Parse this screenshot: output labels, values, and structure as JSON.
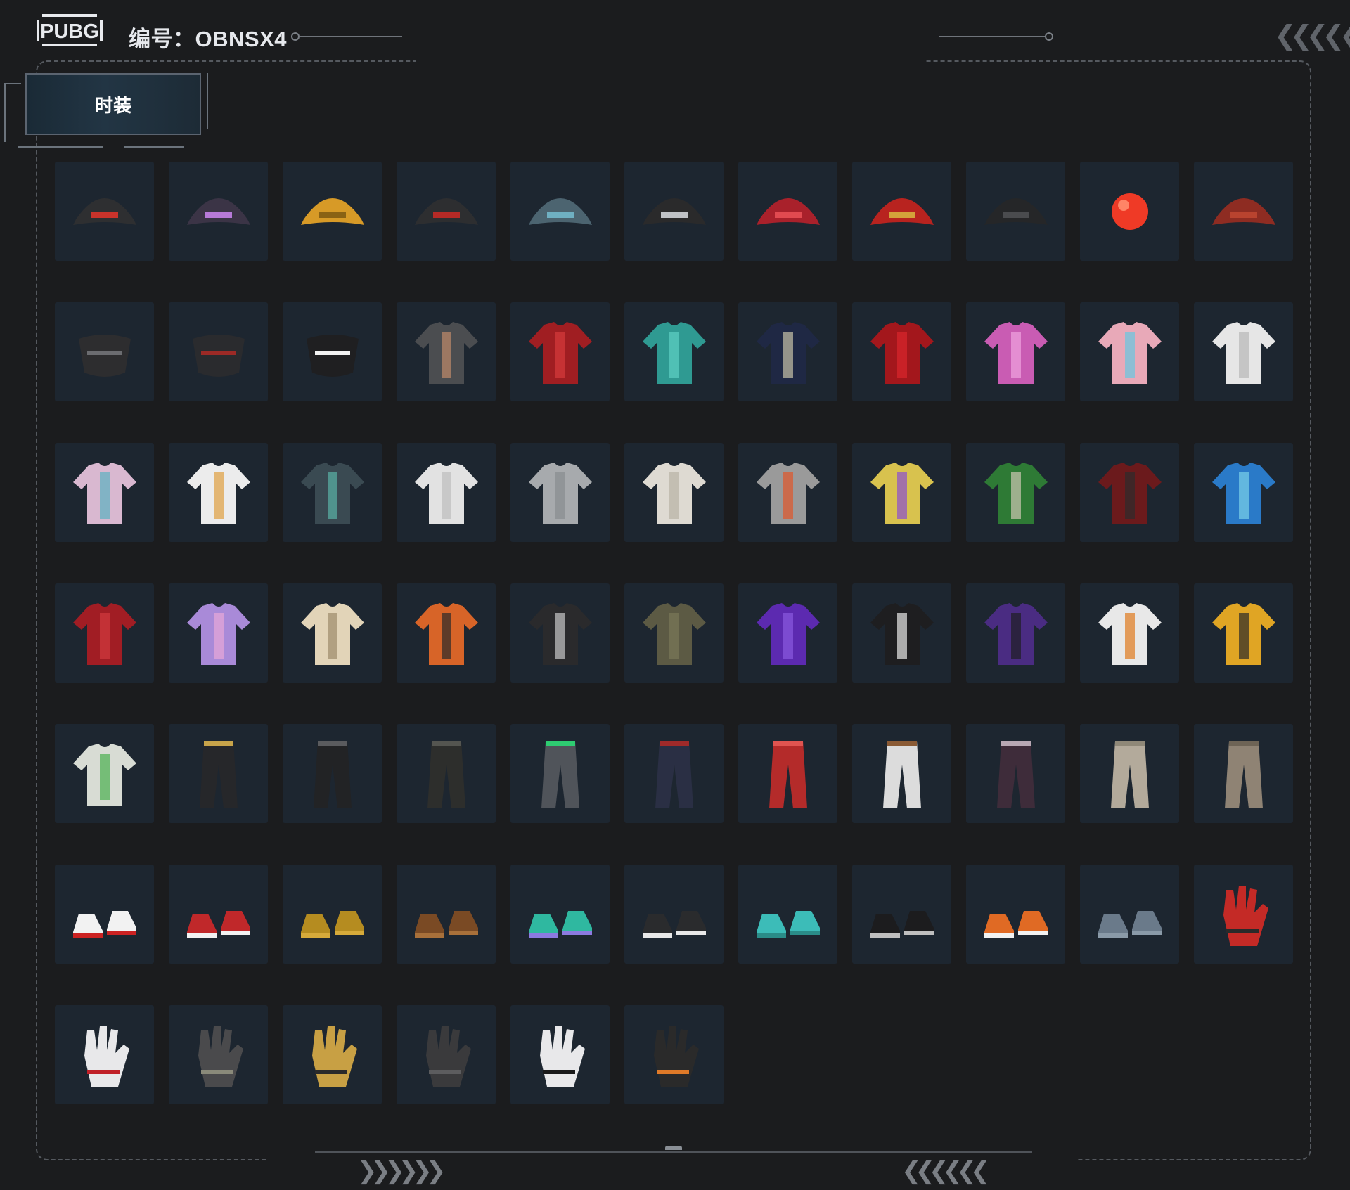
{
  "header": {
    "logo_text": "PUBG",
    "code_label": "编号：OBNSX4"
  },
  "tab": {
    "label": "时装"
  },
  "items": [
    {
      "icon": "cap-icon",
      "c1": "#2e2f31",
      "c2": "#c9332b"
    },
    {
      "icon": "goggles-hat-icon",
      "c1": "#3b3446",
      "c2": "#b77ad8"
    },
    {
      "icon": "beanie-icon",
      "c1": "#d79a27",
      "c2": "#8a6214"
    },
    {
      "icon": "cap-headphones-icon",
      "c1": "#2d2e30",
      "c2": "#b52a26"
    },
    {
      "icon": "bucket-hat-icon",
      "c1": "#4c6470",
      "c2": "#6fb0c2"
    },
    {
      "icon": "sunglasses-icon",
      "c1": "#2a2a2b",
      "c2": "#bfc2c6"
    },
    {
      "icon": "eye-mask-icon",
      "c1": "#a9212b",
      "c2": "#e14a50"
    },
    {
      "icon": "glasses-icon",
      "c1": "#b8231f",
      "c2": "#d4a13a"
    },
    {
      "icon": "face-mask-icon",
      "c1": "#252628",
      "c2": "#4a4b4e"
    },
    {
      "icon": "clown-nose-icon",
      "c1": "#ef3a26",
      "c2": "#ff8466"
    },
    {
      "icon": "scarf-icon",
      "c1": "#8e2c22",
      "c2": "#b9432f"
    },
    {
      "icon": "spiked-mask-icon",
      "c1": "#2d2d2f",
      "c2": "#6b6c70"
    },
    {
      "icon": "tactical-mask-icon",
      "c1": "#2a2b2e",
      "c2": "#9c2a26"
    },
    {
      "icon": "teeth-mask-icon",
      "c1": "#1f1f21",
      "c2": "#f2f2f2"
    },
    {
      "icon": "tattoo-sleeve-shirt-icon",
      "c1": "#4b4d50",
      "c2": "#c08a6a"
    },
    {
      "icon": "red-dress-icon",
      "c1": "#a01e22",
      "c2": "#d63a3c"
    },
    {
      "icon": "swim-top-icon",
      "c1": "#2f9a92",
      "c2": "#5ed0c4"
    },
    {
      "icon": "navy-dress-icon",
      "c1": "#1f2844",
      "c2": "#c8c2a8"
    },
    {
      "icon": "crop-jacket-icon",
      "c1": "#a3171c",
      "c2": "#d8262c"
    },
    {
      "icon": "pink-top-icon",
      "c1": "#c95cb3",
      "c2": "#f0a4e0"
    },
    {
      "icon": "holo-outfit-icon",
      "c1": "#e8a9b8",
      "c2": "#67c7e0"
    },
    {
      "icon": "sports-bra-icon",
      "c1": "#e6e6e6",
      "c2": "#b6b6b6"
    },
    {
      "icon": "mermaid-outfit-icon",
      "c1": "#d9b8d0",
      "c2": "#5bb0c0"
    },
    {
      "icon": "tank-top-icon",
      "c1": "#ececec",
      "c2": "#e0a040"
    },
    {
      "icon": "hawaiian-shirt-icon",
      "c1": "#3a4a52",
      "c2": "#5ab2a6"
    },
    {
      "icon": "white-tshirt-icon",
      "c1": "#e2e2e2",
      "c2": "#bdbdbd"
    },
    {
      "icon": "grey-tshirt-icon",
      "c1": "#a7aaad",
      "c2": "#888b8e"
    },
    {
      "icon": "white-crop-jacket-icon",
      "c1": "#dedad2",
      "c2": "#b8b2a4"
    },
    {
      "icon": "racing-jacket-icon",
      "c1": "#9a9a9a",
      "c2": "#e0562a"
    },
    {
      "icon": "dog-print-tshirt-icon",
      "c1": "#d8c24e",
      "c2": "#8c4fd0"
    },
    {
      "icon": "puffer-green-jacket-icon",
      "c1": "#2e7a35",
      "c2": "#cfc8b4"
    },
    {
      "icon": "leather-jacket-icon",
      "c1": "#6b1a1c",
      "c2": "#2c2c2c"
    },
    {
      "icon": "holo-jacket-icon",
      "c1": "#2a7ac8",
      "c2": "#7ad2e8"
    },
    {
      "icon": "red-robe-icon",
      "c1": "#a11d24",
      "c2": "#d23a3f"
    },
    {
      "icon": "purple-hoodie-icon",
      "c1": "#a98ad8",
      "c2": "#e8a8d8"
    },
    {
      "icon": "cream-crop-jacket-icon",
      "c1": "#e2d4b8",
      "c2": "#9c8a6a"
    },
    {
      "icon": "orange-tech-jacket-icon",
      "c1": "#d76428",
      "c2": "#2a2a2a"
    },
    {
      "icon": "black-hooded-jacket-icon",
      "c1": "#2a2a2c",
      "c2": "#c8c8c8"
    },
    {
      "icon": "tactical-vest-icon",
      "c1": "#5c5a44",
      "c2": "#7a7758"
    },
    {
      "icon": "purple-jacket-icon",
      "c1": "#5c2ab0",
      "c2": "#8a5ae0"
    },
    {
      "icon": "black-aura-hoodie-icon",
      "c1": "#1e1e20",
      "c2": "#e8e8e8"
    },
    {
      "icon": "purple-camo-jacket-icon",
      "c1": "#4a2c82",
      "c2": "#1e1e22"
    },
    {
      "icon": "white-orange-jacket-icon",
      "c1": "#e8e8e8",
      "c2": "#e07a1e"
    },
    {
      "icon": "yellow-puffer-vest-icon",
      "c1": "#e0a524",
      "c2": "#2a2a2a"
    },
    {
      "icon": "sprout-hoodie-icon",
      "c1": "#d8dcd4",
      "c2": "#4caf50"
    },
    {
      "icon": "black-pants-gold-icon",
      "c1": "#26272a",
      "c2": "#c8a44a"
    },
    {
      "icon": "leather-pants-icon",
      "c1": "#222325",
      "c2": "#5a5b5e"
    },
    {
      "icon": "cargo-pants-icon",
      "c1": "#2d2e2c",
      "c2": "#545550"
    },
    {
      "icon": "plaid-skirt-icon",
      "c1": "#50545a",
      "c2": "#2ecc71"
    },
    {
      "icon": "shorts-stockings-icon",
      "c1": "#2a2f44",
      "c2": "#a02a2a"
    },
    {
      "icon": "red-track-pants-icon",
      "c1": "#b42b2a",
      "c2": "#e05450"
    },
    {
      "icon": "white-shorts-icon",
      "c1": "#dcdcdc",
      "c2": "#8a5a34"
    },
    {
      "icon": "camo-pants-icon",
      "c1": "#3e2c3a",
      "c2": "#b8a8b4"
    },
    {
      "icon": "beige-pants-icon",
      "c1": "#b3aa9b",
      "c2": "#8f8878"
    },
    {
      "icon": "taupe-pants-icon",
      "c1": "#8f8374",
      "c2": "#6e6456"
    },
    {
      "icon": "white-sneakers-icon",
      "c1": "#f2f2f2",
      "c2": "#cc2222"
    },
    {
      "icon": "red-high-tops-icon",
      "c1": "#c0282a",
      "c2": "#f2f2f2"
    },
    {
      "icon": "yellow-shoes-icon",
      "c1": "#b58c20",
      "c2": "#d6aa3a"
    },
    {
      "icon": "paw-slippers-icon",
      "c1": "#7a4a24",
      "c2": "#a8703a"
    },
    {
      "icon": "checker-socks-icon",
      "c1": "#2fb8a0",
      "c2": "#8c7ae0"
    },
    {
      "icon": "black-sneakers-icon",
      "c1": "#2a2b2d",
      "c2": "#e8e8e8"
    },
    {
      "icon": "teal-clogs-icon",
      "c1": "#3cbcb8",
      "c2": "#2a8c88"
    },
    {
      "icon": "fur-boots-icon",
      "c1": "#1c1c1e",
      "c2": "#bfbfbf"
    },
    {
      "icon": "orange-boots-icon",
      "c1": "#e06a24",
      "c2": "#f2f2f2"
    },
    {
      "icon": "camo-boots-icon",
      "c1": "#6a7a8a",
      "c2": "#8a9aa8"
    },
    {
      "icon": "moto-gloves-icon",
      "c1": "#c42a26",
      "c2": "#2a2a2a"
    },
    {
      "icon": "hand-red-nails-icon",
      "c1": "#e8e8ea",
      "c2": "#c02028"
    },
    {
      "icon": "fingerless-gloves-icon",
      "c1": "#4a4a4c",
      "c2": "#8a8a7a"
    },
    {
      "icon": "rings-accessories-icon",
      "c1": "#c8a044",
      "c2": "#2a2a2a"
    },
    {
      "icon": "wrap-gloves-icon",
      "c1": "#3a3a3c",
      "c2": "#5c5c5e"
    },
    {
      "icon": "hand-black-nails-icon",
      "c1": "#e8e8ea",
      "c2": "#1a1a1a"
    },
    {
      "icon": "orange-black-gloves-icon",
      "c1": "#2a2a2a",
      "c2": "#e07a28"
    }
  ]
}
